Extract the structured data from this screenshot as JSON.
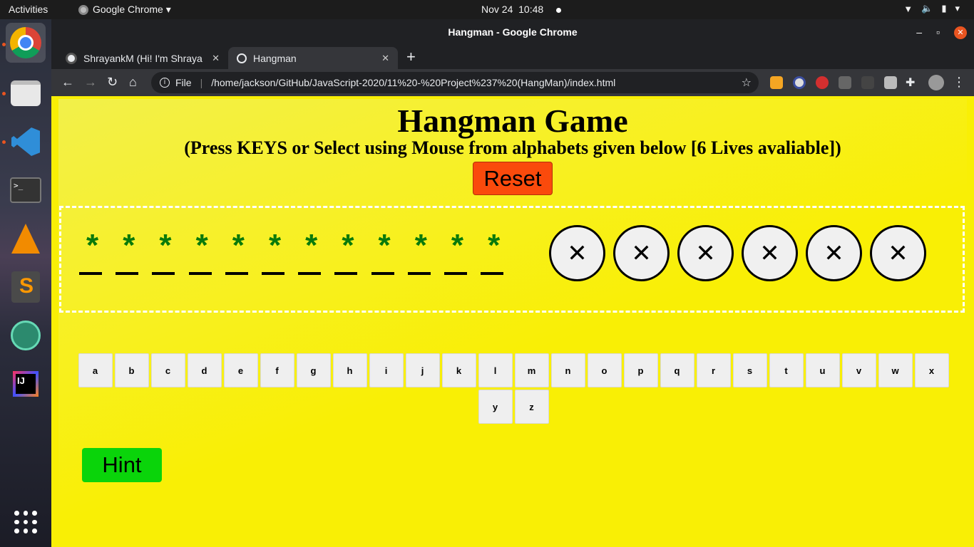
{
  "topbar": {
    "activities": "Activities",
    "app_name": "Google Chrome ▾",
    "date": "Nov 24",
    "time": "10:48"
  },
  "window": {
    "title": "Hangman - Google Chrome"
  },
  "tabs": [
    {
      "label": "ShrayankM (Hi! I'm Shraya",
      "icon": "github-icon"
    },
    {
      "label": "Hangman",
      "icon": "globe-icon"
    }
  ],
  "omnibox": {
    "scheme_label": "File",
    "url": "/home/jackson/GitHub/JavaScript-2020/11%20-%20Project%237%20(HangMan)/index.html"
  },
  "game": {
    "title": "Hangman Game",
    "subtitle": "(Press KEYS or Select using Mouse from alphabets given below [6 Lives avaliable])",
    "reset_label": "Reset",
    "hint_label": "Hint",
    "masked_word": [
      "*",
      "*",
      "*",
      "*",
      "*",
      "*",
      "*",
      "*",
      "*",
      "*",
      "*",
      "*"
    ],
    "lives": [
      "✕",
      "✕",
      "✕",
      "✕",
      "✕",
      "✕"
    ],
    "keyboard_rows": [
      [
        "a",
        "b",
        "c",
        "d",
        "e",
        "f",
        "g",
        "h",
        "i",
        "j",
        "k",
        "l",
        "m",
        "n",
        "o",
        "p",
        "q",
        "r",
        "s",
        "t",
        "u",
        "v",
        "w",
        "x"
      ],
      [
        "y",
        "z"
      ]
    ]
  },
  "colors": {
    "page_bg": "#f9ef05",
    "reset_bg": "#fa4a0c",
    "hint_bg": "#0ad40a",
    "word_color": "#0a7a0a"
  }
}
